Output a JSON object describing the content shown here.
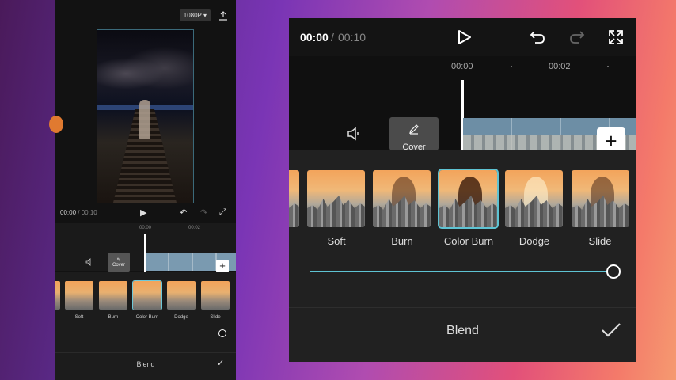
{
  "left_panel": {
    "resolution": "1080P",
    "time_current": "00:00",
    "time_total": "/ 00:10",
    "ruler": [
      "00:00",
      "00:02"
    ],
    "cover_label": "Cover",
    "blend_options": [
      "Soft",
      "Burn",
      "Color Burn",
      "Dodge",
      "Slide"
    ],
    "selected_option": "Color Burn",
    "panel_title": "Blend"
  },
  "main": {
    "time_current": "00:00",
    "time_sep": "/",
    "time_total": "00:10",
    "ruler_labels": [
      "00:00",
      "00:02"
    ],
    "cover_label": "Cover",
    "add_label": "+",
    "blend_options": [
      "Soft",
      "Burn",
      "Color Burn",
      "Dodge",
      "Slide"
    ],
    "selected_option": "Color Burn",
    "opacity_value": 1.0,
    "panel_title": "Blend"
  },
  "colors": {
    "accent": "#5ec3d3",
    "panel_bg": "#212121"
  }
}
